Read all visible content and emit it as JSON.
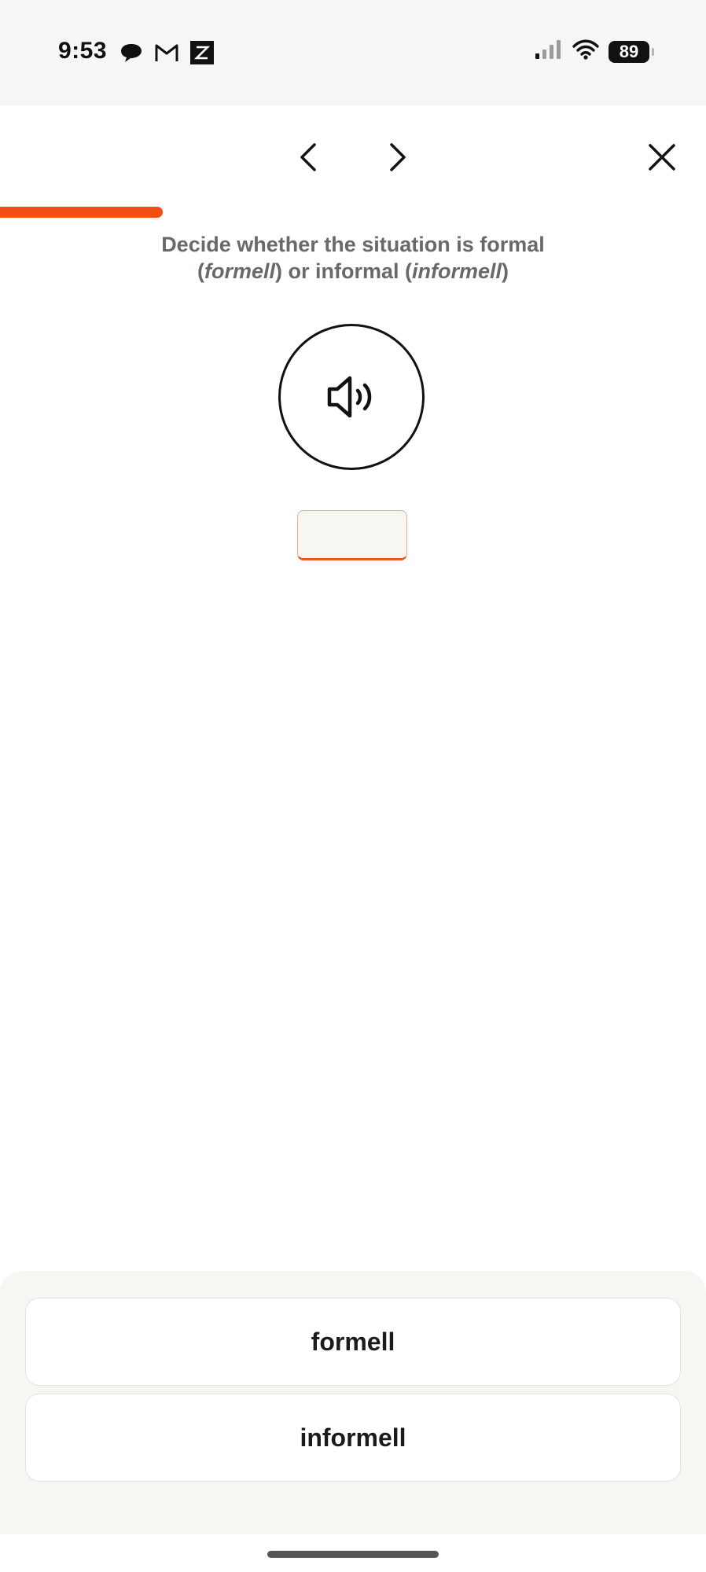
{
  "status_bar": {
    "time": "9:53",
    "left_icons": [
      "chat-bubble-icon",
      "gmail-icon",
      "zoom-z-icon"
    ],
    "right_icons": [
      "signal-icon",
      "wifi-icon"
    ],
    "battery": "89"
  },
  "nav": {
    "back_icon": "chevron-left-icon",
    "forward_icon": "chevron-right-icon",
    "close_icon": "close-icon"
  },
  "progress": {
    "fraction": 0.23,
    "color": "#f24e14"
  },
  "instruction": {
    "line1": "Decide whether the situation is formal",
    "line2_open": "(",
    "term1": "formell",
    "line2_mid": ") or informal (",
    "term2": "informell",
    "line2_close": ")"
  },
  "audio": {
    "icon": "speaker-icon"
  },
  "options": [
    {
      "label": "formell"
    },
    {
      "label": "informell"
    }
  ],
  "colors": {
    "accent": "#f24e14",
    "instruction_text": "#666a6a"
  }
}
